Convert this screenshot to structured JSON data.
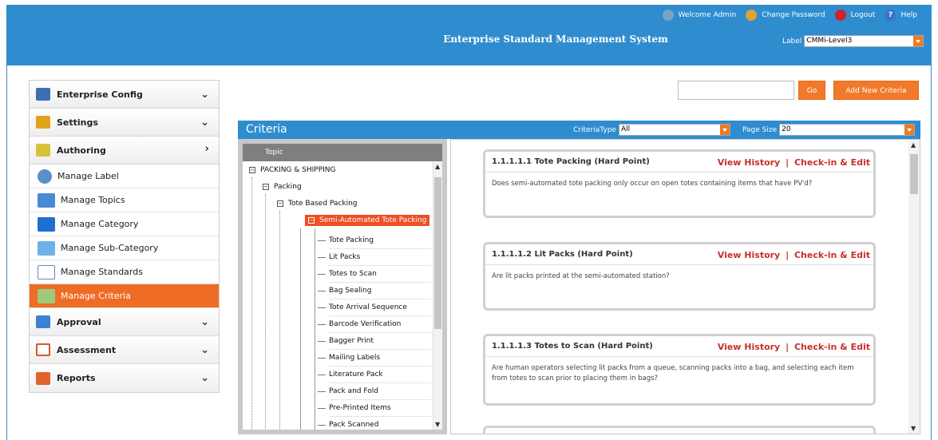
{
  "header": {
    "title": "Enterprise Standard Management System",
    "welcome": "Welcome Admin",
    "change_password": "Change Password",
    "logout": "Logout",
    "help": "Help",
    "label_caption": "Label",
    "label_value": "CMMi-Level3"
  },
  "sidebar": {
    "items": [
      {
        "label": "Enterprise Config",
        "icon": "enterprise-config-icon"
      },
      {
        "label": "Settings",
        "icon": "settings-icon"
      },
      {
        "label": "Authoring",
        "icon": "authoring-icon"
      }
    ],
    "sub_items": [
      {
        "label": "Manage Label"
      },
      {
        "label": "Manage Topics"
      },
      {
        "label": "Manage Category"
      },
      {
        "label": "Manage Sub-Category"
      },
      {
        "label": "Manage Standards"
      },
      {
        "label": "Manage Criteria"
      }
    ],
    "bottom_items": [
      {
        "label": "Approval"
      },
      {
        "label": "Assessment"
      },
      {
        "label": "Reports"
      }
    ]
  },
  "toolbar": {
    "search_value": "",
    "go_label": "Go",
    "add_label": "Add New Criteria"
  },
  "criteria": {
    "title": "Criteria",
    "type_caption": "CriteriaType",
    "type_value": "All",
    "page_size_caption": "Page Size",
    "page_size_value": "20"
  },
  "tree": {
    "header": "Topic",
    "root": "PACKING & SHIPPING",
    "level1": "Packing",
    "level2": "Tote Based Packing",
    "selected": "Semi-Automated Tote Packing",
    "leaves": [
      "Tote Packing",
      "Lit Packs",
      "Totes to Scan",
      "Bag Sealing",
      "Tote Arrival Sequence",
      "Barcode Verification",
      "Bagger Print",
      "Mailing Labels",
      "Literature Pack",
      "Pack and Fold",
      "Pre-Printed Items",
      "Pack Scanned"
    ]
  },
  "cards": [
    {
      "title": "1.1.1.1.1 Tote Packing (Hard Point)",
      "view_history": "View History",
      "sep": "|",
      "checkin": "Check-in & Edit",
      "body": "Does semi-automated tote packing only occur on open totes containing items that have PV'd?"
    },
    {
      "title": "1.1.1.1.2 Lit Packs (Hard Point)",
      "view_history": "View History",
      "sep": "|",
      "checkin": "Check-in & Edit",
      "body": "Are lit packs printed at the semi-automated station?"
    },
    {
      "title": "1.1.1.1.3 Totes to Scan (Hard Point)",
      "view_history": "View History",
      "sep": "|",
      "checkin": "Check-in & Edit",
      "body": "Are human operators selecting lit packs from a queue, scanning packs into a bag, and selecting each item from totes to scan prior to placing them in bags?"
    }
  ],
  "colors": {
    "header_blue": "#2f8ccf",
    "accent_orange": "#ef6c25",
    "link_red": "#c8302a"
  }
}
